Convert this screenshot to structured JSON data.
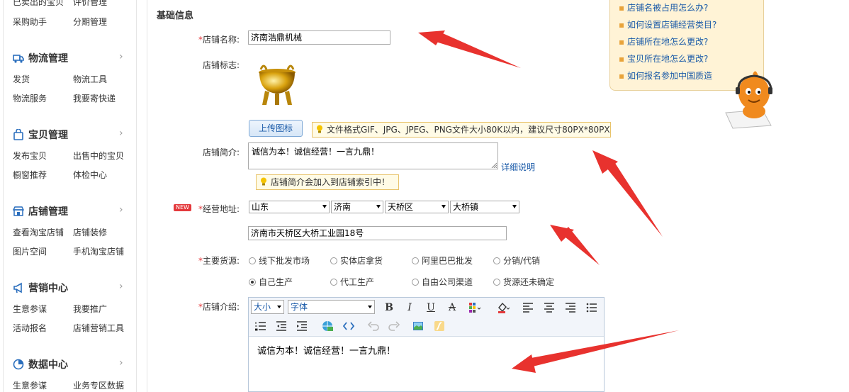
{
  "sidebar": {
    "top_links": [
      "已卖出的宝贝",
      "评价管理",
      "采购助手",
      "分期管理"
    ],
    "sections": [
      {
        "title": "物流管理",
        "icon": "truck-icon",
        "links": [
          "发货",
          "物流工具",
          "物流服务",
          "我要寄快递"
        ]
      },
      {
        "title": "宝贝管理",
        "icon": "bag-icon",
        "links": [
          "发布宝贝",
          "出售中的宝贝",
          "橱窗推荐",
          "体检中心"
        ]
      },
      {
        "title": "店铺管理",
        "icon": "shop-icon",
        "links": [
          "查看淘宝店铺",
          "店铺装修",
          "图片空间",
          "手机淘宝店铺"
        ]
      },
      {
        "title": "营销中心",
        "icon": "megaphone-icon",
        "links": [
          "生意参谋",
          "我要推广",
          "活动报名",
          "店铺营销工具"
        ]
      },
      {
        "title": "数据中心",
        "icon": "chart-icon",
        "links": [
          "生意参谋",
          "业务专区数据"
        ]
      }
    ]
  },
  "help": {
    "links": [
      "店铺名被占用怎么办?",
      "如何设置店铺经营类目?",
      "店铺所在地怎么更改?",
      "宝贝所在地怎么更改?",
      "如何报名参加中国质造"
    ]
  },
  "form": {
    "section_title": "基础信息",
    "shop_name": {
      "label": "店铺名称:",
      "value": "济南浩鼎机械"
    },
    "shop_logo": {
      "label": "店铺标志:",
      "upload_label": "上传图标",
      "tip": "文件格式GIF、JPG、JPEG、PNG文件大小80K以内，建议尺寸80PX*80PX"
    },
    "shop_intro": {
      "label": "店铺简介:",
      "value": "诚信为本！诚信经营！一言九鼎！",
      "detail_link": "详细说明",
      "tip": "店铺简介会加入到店铺索引中！"
    },
    "address": {
      "label": "经营地址:",
      "new_badge": "NEW",
      "province": "山东",
      "city": "济南",
      "district": "天桥区",
      "town": "大桥镇",
      "detail": "济南市天桥区大桥工业园18号"
    },
    "supply": {
      "label": "主要货源:",
      "options": [
        "线下批发市场",
        "实体店拿货",
        "阿里巴巴批发",
        "分销/代销",
        "自己生产",
        "代工生产",
        "自由公司渠道",
        "货源还未确定"
      ],
      "selected": "自己生产"
    },
    "description": {
      "label": "店铺介绍:",
      "font_size_select": "大小",
      "font_family_select": "字体",
      "content": "诚信为本！诚信经营！一言九鼎！"
    }
  },
  "colors": {
    "required": "#e4393c",
    "link": "#1a5aa8",
    "arrow": "#e8322e",
    "tip_bg": "#fffbe6"
  }
}
